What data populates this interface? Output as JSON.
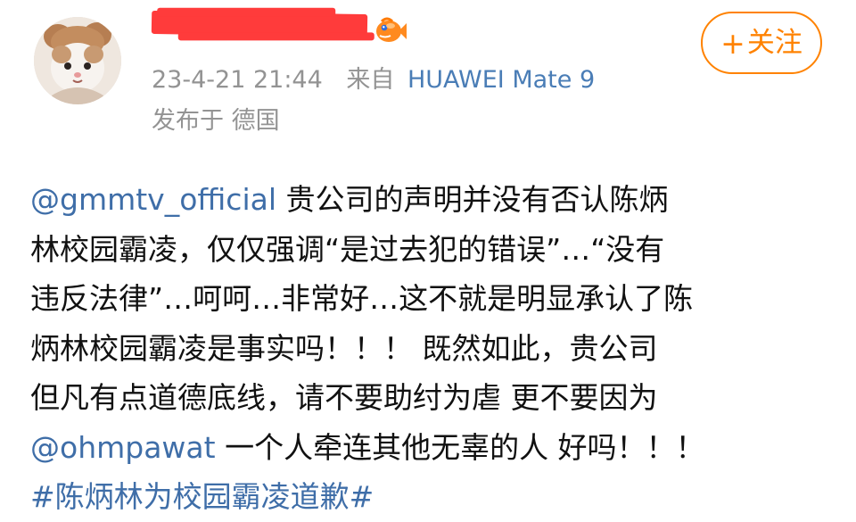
{
  "header": {
    "follow_label": "关注",
    "follow_plus": "+",
    "timestamp": "23-4-21 21:44",
    "source_prefix": "来自",
    "device": "HUAWEI Mate 9",
    "location": "发布于 德国",
    "avatar_icon": "cat-avatar-icon",
    "badge_icon": "fish-badge-icon"
  },
  "post": {
    "lines": [
      [
        "@gmmtv_official",
        " 贵公司的声明并没有否认陈炳"
      ],
      [
        "林校园霸凌，仅仅强调“是过去犯的错误”…“没有"
      ],
      [
        "违反法律”…呵呵…非常好…这不就是明显承认了陈"
      ],
      [
        "炳林校园霸凌是事实吗！！！ 既然如此，贵公司"
      ],
      [
        "但凡有点道德底线，请不要助纣为虐 更不要因为"
      ],
      [
        "@ohmpawat",
        " 一个人牵连其他无辜的人 好吗！！！"
      ],
      [
        "#陈炳林为校园霸凌道歉#"
      ]
    ]
  },
  "colors": {
    "accent": "#ff8200",
    "link": "#3f6ea8",
    "meta": "#939393",
    "redaction": "#ff3b3b"
  }
}
